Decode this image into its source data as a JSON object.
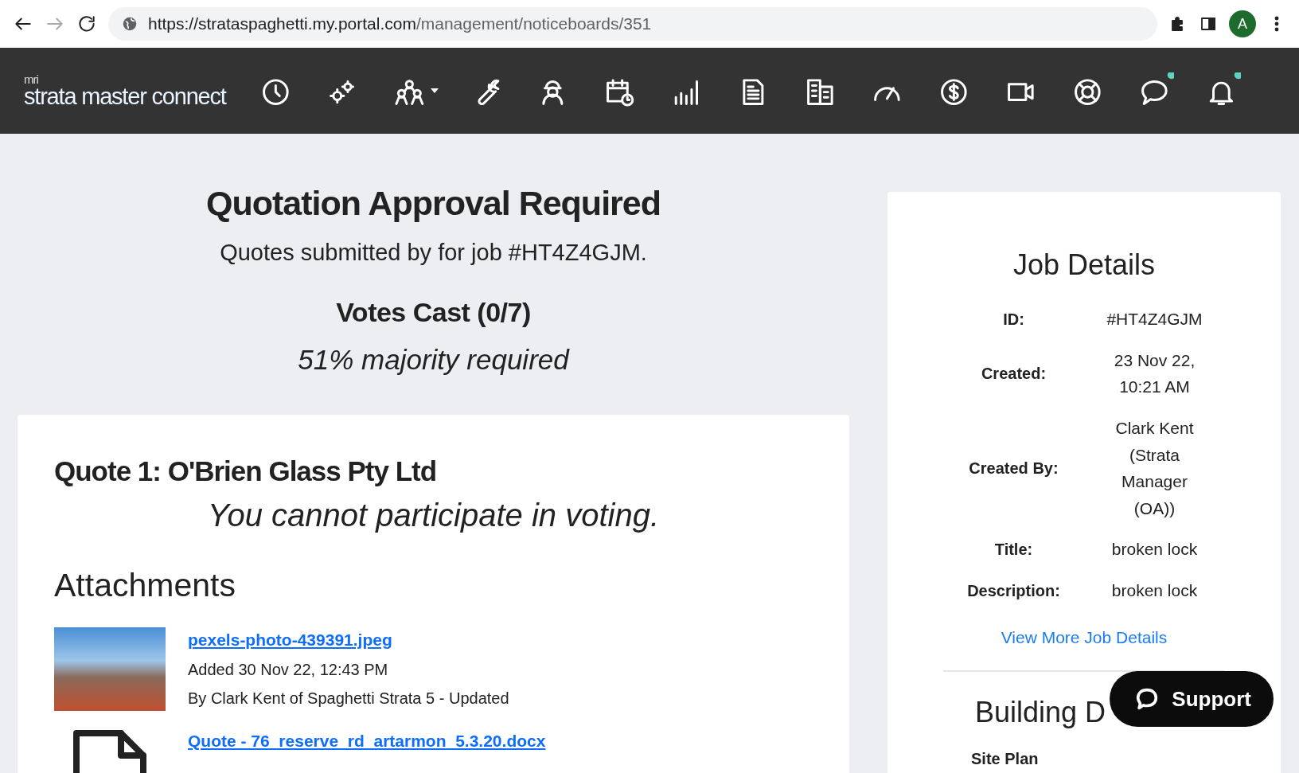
{
  "browser": {
    "url_host": "https://strataspaghetti.my.portal.com",
    "url_path": "/management/noticeboards/351",
    "profile_initial": "A"
  },
  "app": {
    "logo_small": "mri",
    "logo": "strata master connect",
    "nav_icons": [
      {
        "kind": "clock",
        "notification": false
      },
      {
        "kind": "gears",
        "notification": false
      },
      {
        "kind": "people",
        "notification": false,
        "dropdown": true
      },
      {
        "kind": "wrench",
        "notification": false
      },
      {
        "kind": "worker",
        "notification": false
      },
      {
        "kind": "calendar",
        "notification": false
      },
      {
        "kind": "chart",
        "notification": false
      },
      {
        "kind": "document",
        "notification": false
      },
      {
        "kind": "building",
        "notification": false
      },
      {
        "kind": "gauge",
        "notification": false
      },
      {
        "kind": "dollar",
        "notification": false
      },
      {
        "kind": "video",
        "notification": false
      },
      {
        "kind": "lifebuoy",
        "notification": false
      },
      {
        "kind": "chat",
        "notification": true
      },
      {
        "kind": "bell",
        "notification": true
      }
    ]
  },
  "header": {
    "title": "Quotation Approval Required",
    "subtitle": "Quotes submitted by for job #HT4Z4GJM.",
    "votes": "Votes Cast (0/7)",
    "majority": "51% majority required"
  },
  "quote": {
    "title": "Quote 1: O'Brien Glass Pty Ltd",
    "notice": "You cannot participate in voting.",
    "attachments_heading": "Attachments",
    "attachments": [
      {
        "kind": "photo",
        "name": "pexels-photo-439391.jpeg",
        "added": "Added 30 Nov 22, 12:43 PM",
        "by": "By Clark Kent of Spaghetti Strata 5 - Updated"
      },
      {
        "kind": "file",
        "name": "Quote - 76_reserve_rd_artarmon_5.3.20.docx"
      }
    ]
  },
  "job_details": {
    "title": "Job Details",
    "rows": [
      {
        "label": "ID:",
        "value": "#HT4Z4GJM"
      },
      {
        "label": "Created:",
        "value": "23 Nov 22, 10:21 AM"
      },
      {
        "label": "Created By:",
        "value": "Clark Kent (Strata Manager (OA))"
      },
      {
        "label": "Title:",
        "value": "broken lock"
      },
      {
        "label": "Description:",
        "value": "broken lock"
      }
    ],
    "link": "View More Job Details"
  },
  "building_details": {
    "title": "Building D",
    "first_label": "Site Plan"
  },
  "support_button": "Support"
}
